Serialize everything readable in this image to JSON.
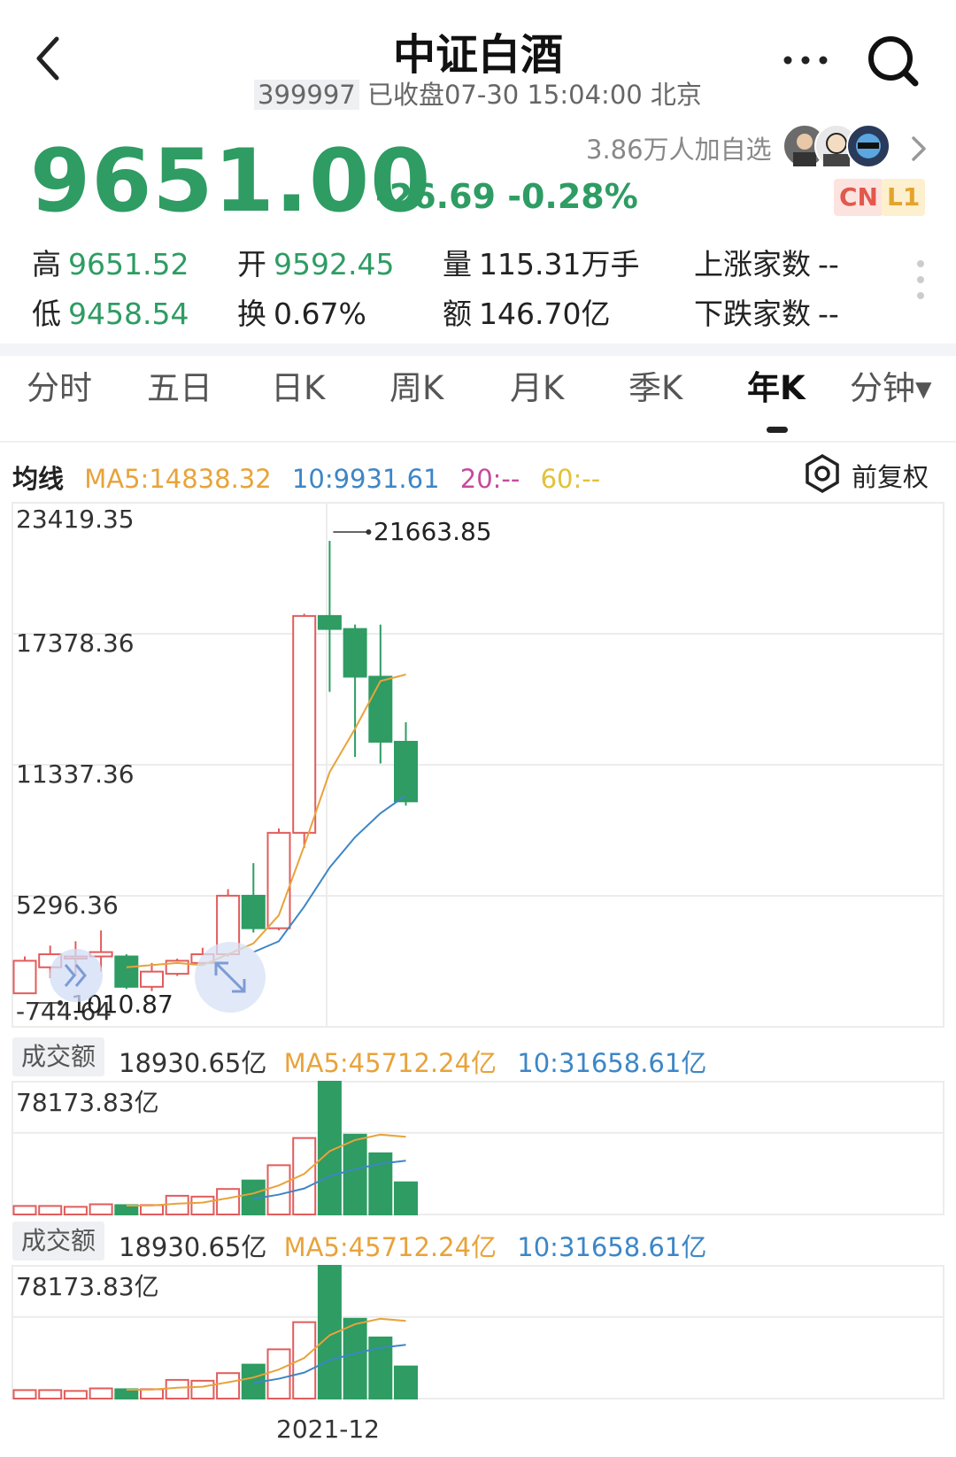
{
  "header": {
    "title": "中证白酒",
    "code": "399997",
    "status": "已收盘07-30 15:04:00 北京",
    "back_icon": "back-arrow-icon",
    "more_icon": "more-dots-icon",
    "search_icon": "search-icon"
  },
  "quote": {
    "price": "9651.00",
    "change": "-26.69",
    "change_pct": "-0.28%",
    "followers": "3.86万人加自选",
    "badge_cn": "CN",
    "badge_l1": "L1"
  },
  "stats": {
    "high_label": "高",
    "high": "9651.52",
    "open_label": "开",
    "open": "9592.45",
    "volume_label": "量",
    "volume": "115.31万手",
    "up_count_label": "上涨家数",
    "up_count": "--",
    "low_label": "低",
    "low": "9458.54",
    "turnover_label": "换",
    "turnover": "0.67%",
    "amount_label": "额",
    "amount": "146.70亿",
    "down_count_label": "下跌家数",
    "down_count": "--"
  },
  "tabs": [
    {
      "label": "分时"
    },
    {
      "label": "五日"
    },
    {
      "label": "日K"
    },
    {
      "label": "周K"
    },
    {
      "label": "月K"
    },
    {
      "label": "季K"
    },
    {
      "label": "年K",
      "active": true
    },
    {
      "label": "分钟▾"
    }
  ],
  "ma_bar": {
    "label": "均线",
    "ma5": "MA5:14838.32",
    "ma10": "10:9931.61",
    "ma20": "20:--",
    "ma60": "60:--",
    "adjust": "前复权",
    "adjust_icon": "settings-hex-icon"
  },
  "colors": {
    "up": "#e25c5c",
    "down": "#2e9c63",
    "ma5": "#e8a33a",
    "ma10": "#3d86c6",
    "ma20": "#c64a9c",
    "ma60": "#e2c13a"
  },
  "chart_data": {
    "type": "candlestick",
    "y_ticks": [
      "23419.35",
      "17378.36",
      "11337.36",
      "5296.36",
      "-744.64"
    ],
    "ylim": [
      -744.64,
      23419.35
    ],
    "high_marker": "21663.85",
    "low_marker": "1010.87",
    "x_tick": "2021-12",
    "candles": [
      {
        "o": 800,
        "c": 2300,
        "h": 2500,
        "l": 800
      },
      {
        "o": 2000,
        "c": 2600,
        "h": 3000,
        "l": 1500
      },
      {
        "o": 2400,
        "c": 2500,
        "h": 3200,
        "l": 1600
      },
      {
        "o": 2500,
        "c": 2700,
        "h": 3700,
        "l": 1800
      },
      {
        "o": 2500,
        "c": 1100,
        "h": 2600,
        "l": 1000
      },
      {
        "o": 1100,
        "c": 1800,
        "h": 2200,
        "l": 900
      },
      {
        "o": 1700,
        "c": 2300,
        "h": 2400,
        "l": 1600
      },
      {
        "o": 2200,
        "c": 2600,
        "h": 2900,
        "l": 2100
      },
      {
        "o": 2600,
        "c": 5300,
        "h": 5600,
        "l": 2500
      },
      {
        "o": 5300,
        "c": 3800,
        "h": 6800,
        "l": 3600
      },
      {
        "o": 3800,
        "c": 8200,
        "h": 8400,
        "l": 3700
      },
      {
        "o": 8200,
        "c": 18200,
        "h": 18300,
        "l": 7500
      },
      {
        "o": 18200,
        "c": 17600,
        "h": 21663.85,
        "l": 14700
      },
      {
        "o": 17600,
        "c": 15400,
        "h": 17800,
        "l": 11700
      },
      {
        "o": 15400,
        "c": 12400,
        "h": 17800,
        "l": 11400
      },
      {
        "o": 12400,
        "c": 9651,
        "h": 13300,
        "l": 9459
      }
    ],
    "ma5": [
      null,
      null,
      null,
      null,
      2000,
      2100,
      2200,
      2100,
      2600,
      3100,
      4400,
      7600,
      11000,
      13000,
      15200,
      15500
    ],
    "ma10": [
      null,
      null,
      null,
      null,
      null,
      null,
      null,
      null,
      null,
      2700,
      3200,
      4800,
      6600,
      8000,
      9100,
      9931.61
    ]
  },
  "volume_panels": [
    {
      "label": "成交额",
      "value": "18930.65亿",
      "ma5": "MA5:45712.24亿",
      "ma10": "10:31658.61亿",
      "max": "78173.83亿"
    },
    {
      "label": "成交额",
      "value": "18930.65亿",
      "ma5": "MA5:45712.24亿",
      "ma10": "10:31658.61亿",
      "max": "78173.83亿"
    }
  ],
  "volume_data": {
    "max": 78173.83,
    "bars": [
      5000,
      5000,
      4500,
      6000,
      5500,
      5500,
      11000,
      10500,
      15000,
      20000,
      29000,
      45000,
      78173.83,
      47000,
      36000,
      18930.65
    ],
    "ma5": [
      null,
      null,
      null,
      null,
      5200,
      5300,
      6400,
      7000,
      9600,
      12400,
      17100,
      23900,
      37300,
      43800,
      47000,
      45712.24
    ],
    "ma10": [
      null,
      null,
      null,
      null,
      null,
      null,
      null,
      null,
      null,
      9200,
      11700,
      15300,
      22600,
      26600,
      29900,
      31658.61
    ]
  }
}
